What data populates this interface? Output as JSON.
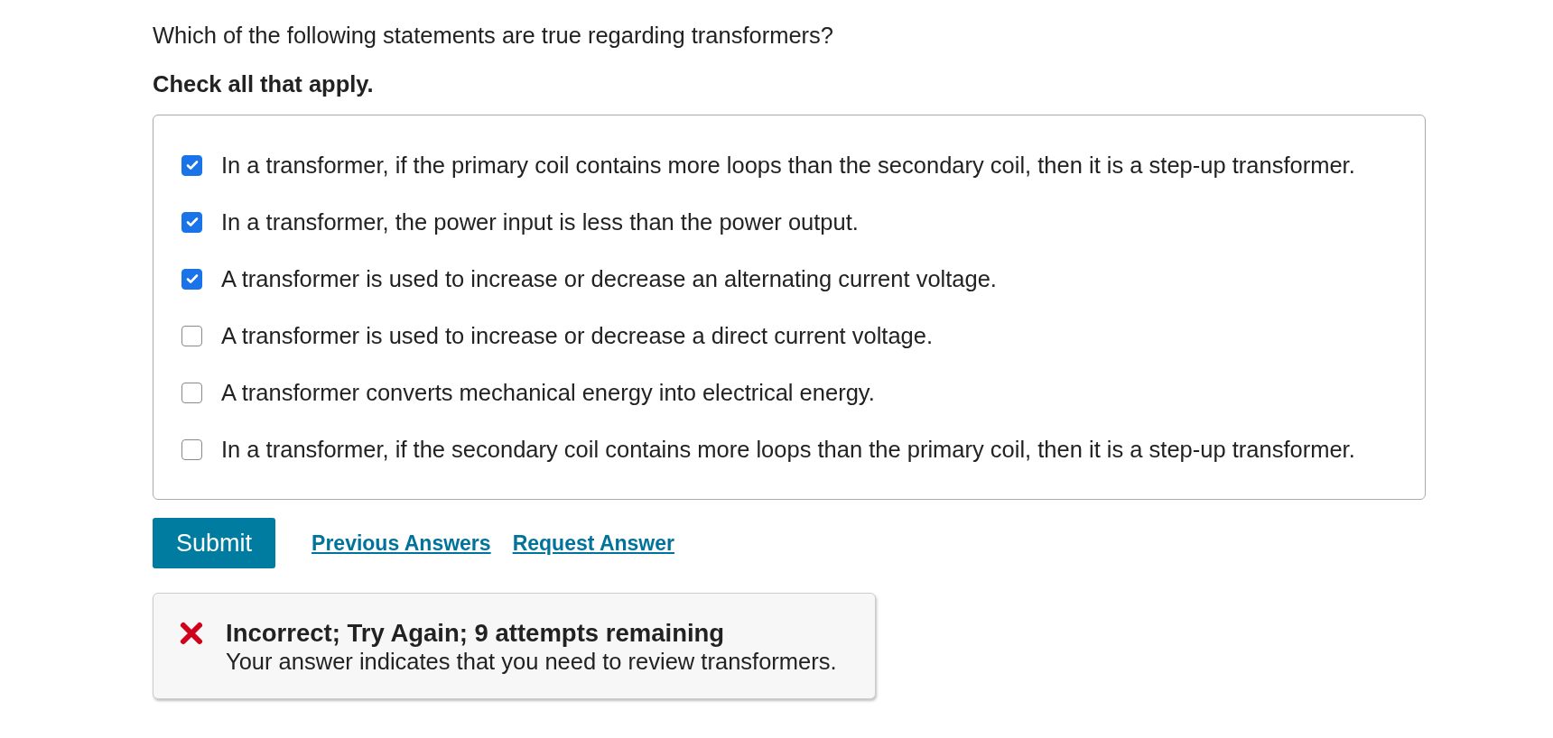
{
  "question": "Which of the following statements are true regarding transformers?",
  "instruction": "Check all that apply.",
  "options": [
    {
      "label": "In a transformer, if the primary coil contains more loops than the secondary coil, then it is a step-up transformer.",
      "checked": true
    },
    {
      "label": "In a transformer, the power input is less than the power output.",
      "checked": true
    },
    {
      "label": "A transformer is used to increase or decrease an alternating current voltage.",
      "checked": true
    },
    {
      "label": "A transformer is used to increase or decrease a direct current voltage.",
      "checked": false
    },
    {
      "label": "A transformer converts mechanical energy into electrical energy.",
      "checked": false
    },
    {
      "label": "In a transformer, if the secondary coil contains more loops than the primary coil, then it is a step-up transformer.",
      "checked": false
    }
  ],
  "submit": "Submit",
  "links": [
    "Previous Answers",
    "Request Answer"
  ],
  "feedback": {
    "kind": "incorrect",
    "title": "Incorrect; Try Again; 9 attempts remaining",
    "message": "Your answer indicates that you need to review transformers."
  }
}
